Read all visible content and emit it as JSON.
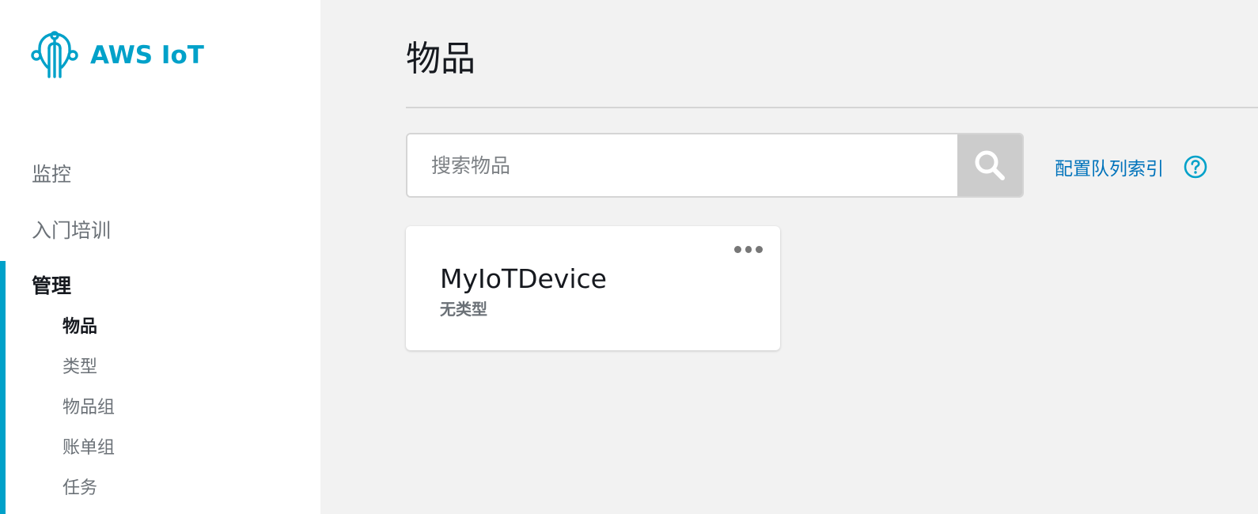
{
  "app": {
    "brand": "AWS IoT",
    "accent_color": "#00a1c9",
    "link_color": "#0073bb"
  },
  "sidebar": {
    "items": [
      {
        "label": "监控"
      },
      {
        "label": "入门培训"
      },
      {
        "label": "管理",
        "active": true
      }
    ],
    "sub_items": [
      {
        "label": "物品",
        "active": true
      },
      {
        "label": "类型"
      },
      {
        "label": "物品组"
      },
      {
        "label": "账单组"
      },
      {
        "label": "任务"
      }
    ]
  },
  "main": {
    "title": "物品",
    "search": {
      "placeholder": "搜索物品",
      "value": ""
    },
    "fleet_index_link": "配置队列索引",
    "cards": [
      {
        "name": "MyIoTDevice",
        "type": "无类型"
      }
    ]
  }
}
